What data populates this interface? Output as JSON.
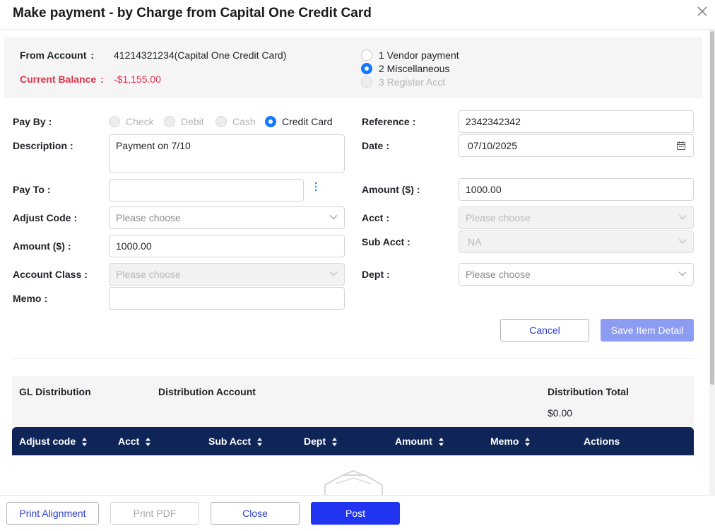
{
  "dialog": {
    "title": "Make payment - by Charge from Capital One Credit Card"
  },
  "info": {
    "from_account_label": "From Account",
    "from_account_value": "41214321234(Capital One Credit Card)",
    "current_balance_label": "Current Balance",
    "current_balance_value": "-$1,155.00",
    "payment_types": [
      {
        "label": "1 Vendor payment",
        "checked": false,
        "disabled": false
      },
      {
        "label": "2 Miscellaneous",
        "checked": true,
        "disabled": false
      },
      {
        "label": "3 Register Acct",
        "checked": false,
        "disabled": true
      }
    ]
  },
  "form": {
    "pay_by_label": "Pay By",
    "pay_by_options": [
      {
        "label": "Check",
        "checked": false,
        "disabled": true
      },
      {
        "label": "Debit",
        "checked": false,
        "disabled": true
      },
      {
        "label": "Cash",
        "checked": false,
        "disabled": true
      },
      {
        "label": "Credit Card",
        "checked": true,
        "disabled": false
      }
    ],
    "description_label": "Description",
    "description_value": "Payment on 7/10",
    "pay_to_label": "Pay To",
    "pay_to_value": "",
    "adjust_code_label": "Adjust Code",
    "adjust_code_placeholder": "Please choose",
    "amount_left_label": "Amount ($)",
    "amount_left_value": "1000.00",
    "account_class_label": "Account Class",
    "account_class_placeholder": "Please choose",
    "memo_label": "Memo",
    "memo_value": "",
    "reference_label": "Reference",
    "reference_value": "2342342342",
    "date_label": "Date",
    "date_value": "07/10/2025",
    "amount_right_label": "Amount ($)",
    "amount_right_value": "1000.00",
    "acct_label": "Acct",
    "acct_placeholder": "Please choose",
    "sub_acct_label": "Sub Acct",
    "sub_acct_value": "NA",
    "dept_label": "Dept",
    "dept_placeholder": "Please choose",
    "colon": ":"
  },
  "item_actions": {
    "cancel_label": "Cancel",
    "save_label": "Save Item Detail"
  },
  "gl": {
    "distribution_label": "GL Distribution",
    "distribution_account_label": "Distribution Account",
    "distribution_total_label": "Distribution Total",
    "distribution_total_value": "$0.00"
  },
  "table": {
    "columns": [
      "Adjust code",
      "Acct",
      "Sub Acct",
      "Dept",
      "Amount",
      "Memo",
      "Actions"
    ],
    "header_color": "#0f2557"
  },
  "footer": {
    "print_alignment_label": "Print Alignment",
    "print_pdf_label": "Print PDF",
    "close_label": "Close",
    "post_label": "Post"
  },
  "colors": {
    "primary": "#2135f0",
    "radio_checked": "#1677ff",
    "balance_red": "#e0334d"
  }
}
